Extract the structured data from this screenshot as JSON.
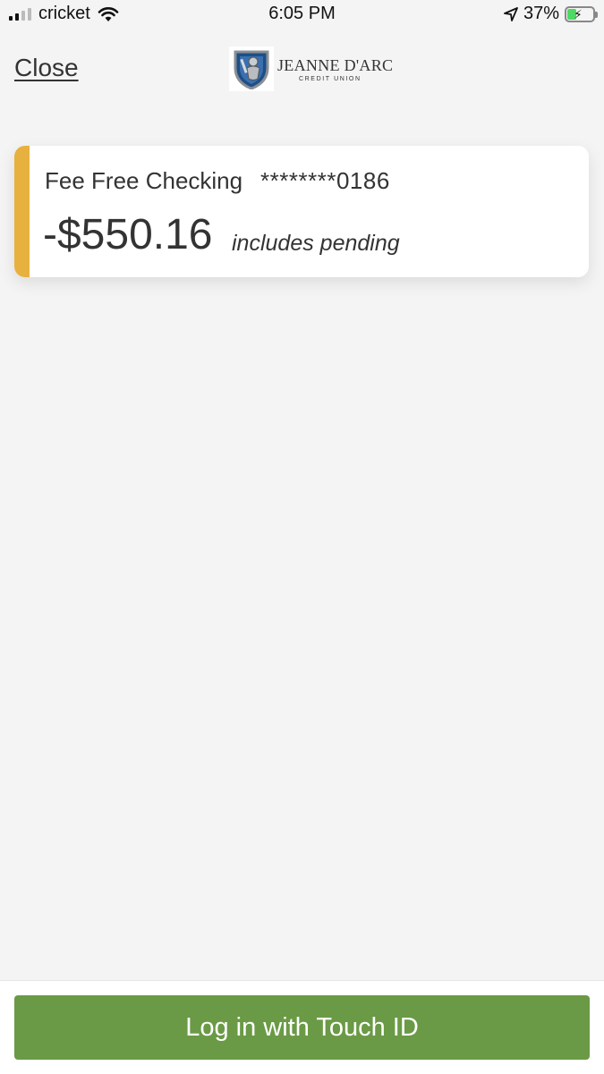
{
  "status_bar": {
    "carrier": "cricket",
    "time": "6:05 PM",
    "battery_percent": "37%",
    "battery_level": 0.37,
    "icons": [
      "signal-icon",
      "wifi-icon",
      "location-arrow-icon",
      "battery-charging-icon"
    ]
  },
  "header": {
    "close_label": "Close",
    "logo": {
      "name": "JEANNE D'ARC",
      "subtitle": "CREDIT UNION",
      "icon": "shield-knight-logo"
    }
  },
  "account": {
    "name": "Fee Free Checking",
    "number": "********0186",
    "balance": "-$550.16",
    "balance_note": "includes pending"
  },
  "footer": {
    "button_label": "Log in with Touch ID"
  },
  "colors": {
    "accent": "#e7b13f",
    "button": "#6a9a45",
    "background": "#f4f4f4",
    "text": "#333333"
  }
}
